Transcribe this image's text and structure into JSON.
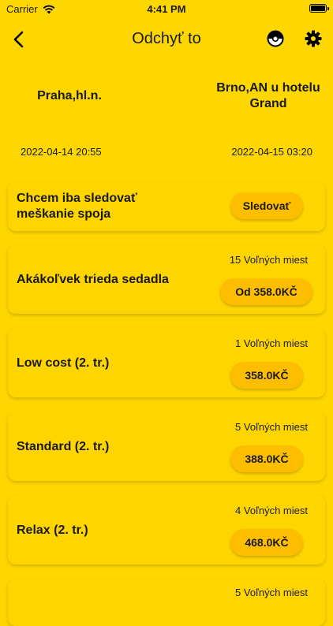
{
  "status": {
    "carrier": "Carrier",
    "time": "4:41 PM"
  },
  "nav": {
    "title": "Odchyť to"
  },
  "route": {
    "from": "Praha,hl.n.",
    "to": "Brno,AN u hotelu Grand",
    "from_time": "2022-04-14 20:55",
    "to_time": "2022-04-15 03:20"
  },
  "track": {
    "label": "Chcem iba sledovať meškanie spoja",
    "button": "Sledovať"
  },
  "classes": [
    {
      "name": "Akákoľvek trieda sedadla",
      "seats": "15 Voľných miest",
      "price": "Od 358.0KČ"
    },
    {
      "name": "Low cost (2. tr.)",
      "seats": "1 Voľných miest",
      "price": "358.0KČ"
    },
    {
      "name": "Standard (2. tr.)",
      "seats": "5 Voľných miest",
      "price": "388.0KČ"
    },
    {
      "name": "Relax (2. tr.)",
      "seats": "4 Voľných miest",
      "price": "468.0KČ"
    },
    {
      "name": "",
      "seats": "5 Voľných miest",
      "price": ""
    }
  ]
}
